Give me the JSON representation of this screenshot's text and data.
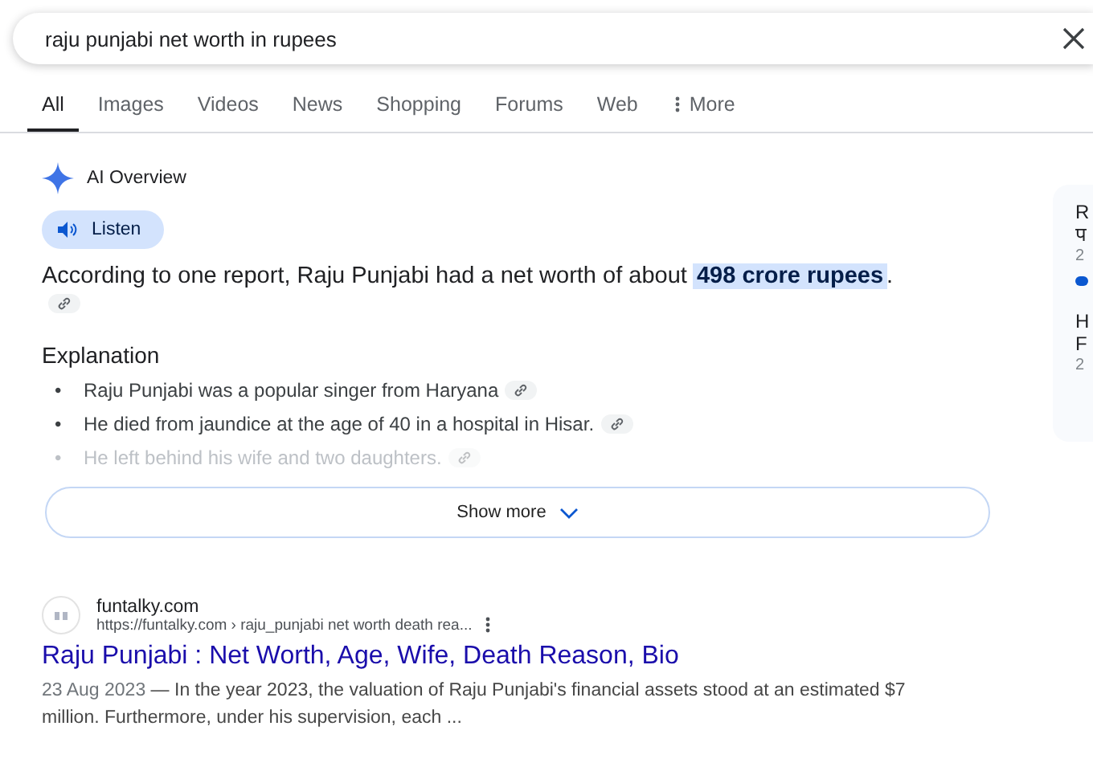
{
  "search": {
    "value": "raju punjabi net worth in rupees"
  },
  "tabs": [
    {
      "label": "All",
      "selected": true
    },
    {
      "label": "Images",
      "selected": false
    },
    {
      "label": "Videos",
      "selected": false
    },
    {
      "label": "News",
      "selected": false
    },
    {
      "label": "Shopping",
      "selected": false
    },
    {
      "label": "Forums",
      "selected": false
    },
    {
      "label": "Web",
      "selected": false
    },
    {
      "label": "More",
      "selected": false,
      "kind": "menu"
    }
  ],
  "ai_overview": {
    "title": "AI Overview",
    "listen_button": "Listen",
    "summary": "According to one report, Raju Punjabi had a net worth of about **498 crore rupees**.",
    "explanation_heading": "Explanation",
    "bullet_marker": "•",
    "bullets": [
      {
        "text": "Raju Punjabi was a popular singer from Haryana",
        "faded": false
      },
      {
        "text": "He died from jaundice at the age of 40 in a hospital in Hisar.",
        "faded": false
      },
      {
        "text": "He left behind his wife and two daughters.",
        "faded": true
      }
    ],
    "show_more": "Show more"
  },
  "side_card": {
    "lines": [
      "R",
      "प",
      "2",
      "H",
      "F",
      "2"
    ]
  },
  "result": {
    "site": "funtalky.com",
    "url": "https://funtalky.com › raju_punjabi net worth death rea...",
    "title": "Raju Punjabi : Net Worth, Age, Wife, Death Reason, Bio",
    "date": "23 Aug 2023",
    "separator": "—",
    "snippet": "In the year 2023, the valuation of Raju Punjabi's financial assets stood at an estimated $7 million. Furthermore, under his supervision, each ..."
  }
}
